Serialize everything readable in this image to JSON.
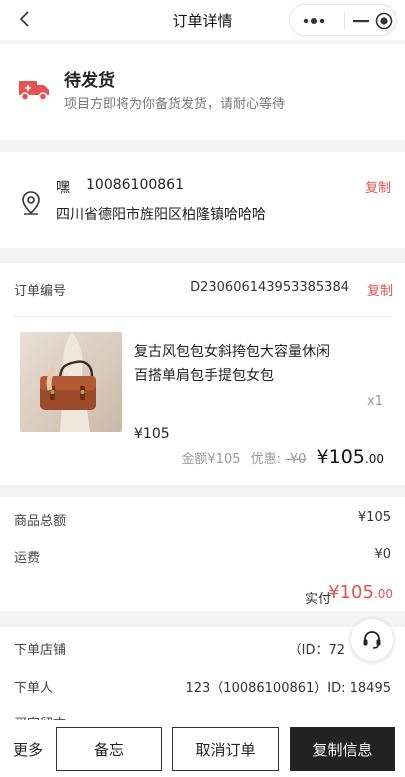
{
  "nav": {
    "title": "订单详情",
    "back_icon": "chevron-left-icon"
  },
  "status": {
    "title": "待发货",
    "subtitle": "项目方即将为你备货发货，请耐心等待",
    "icon": "truck-icon",
    "icon_color": "#e55252"
  },
  "address": {
    "name": "嘿",
    "phone": "10086100861",
    "address": "四川省德阳市旌阳区柏隆镇哈哈哈",
    "copy_label": "复制"
  },
  "order": {
    "number_label": "订单编号",
    "number": "D230606143953385384",
    "copy_label": "复制",
    "product": {
      "name": "复古风包包女斜挎包大容量休闲百搭单肩包手提包女包",
      "quantity": "x1",
      "unit_price": "¥105",
      "amount_label": "金额¥105",
      "discount_label": "优惠:",
      "discount_value": "-¥0",
      "total_big": "¥105",
      "total_small": ".00"
    }
  },
  "totals": {
    "goods_label": "商品总额",
    "goods_value": "¥105",
    "shipping_label": "运费",
    "shipping_value": "¥0",
    "paid_label": "实付",
    "paid_big": "¥105",
    "paid_small": ".00"
  },
  "info": {
    "store_label": "下单店铺",
    "store_value": "（ID：72",
    "buyer_label": "下单人",
    "buyer_value": "123（10086100861）ID: 18495",
    "message_label": "买家留言"
  },
  "bottom": {
    "more": "更多",
    "memo": "备忘",
    "cancel": "取消订单",
    "copy_info": "复制信息"
  },
  "colors": {
    "accent": "#e55252",
    "dark_button": "#222222",
    "background": "#f4f4f4"
  }
}
